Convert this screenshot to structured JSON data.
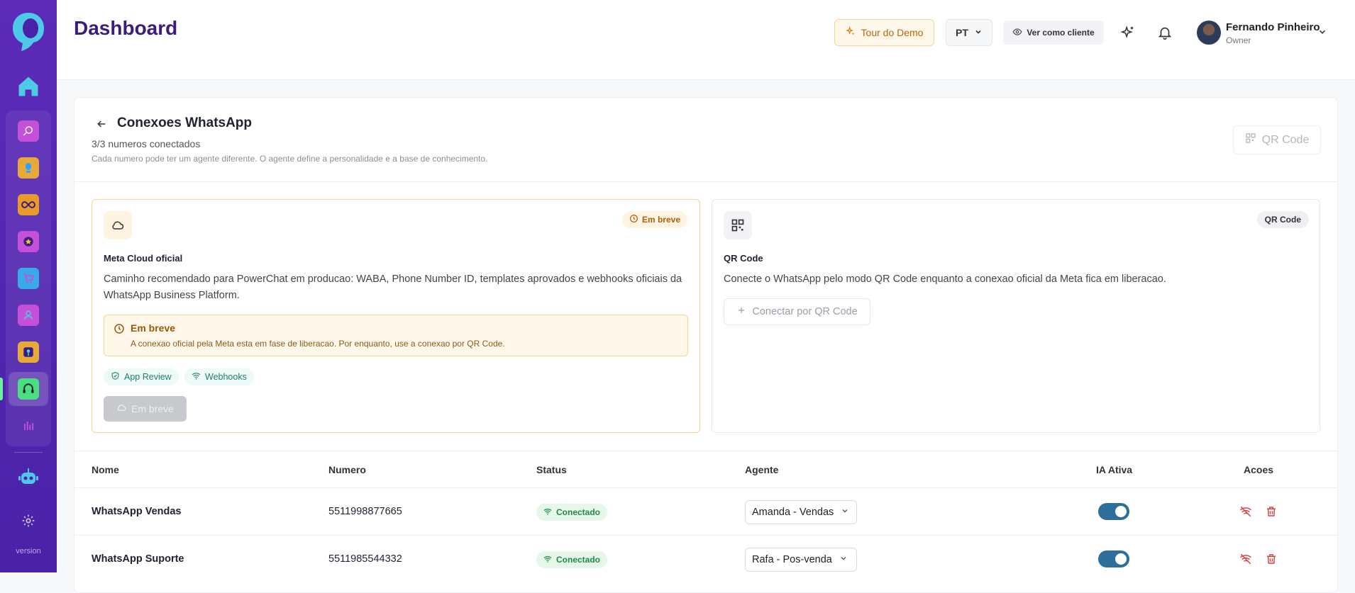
{
  "sidebar": {
    "version_label": "version",
    "items": [
      "search-app",
      "idea-app",
      "infinity-app",
      "star-app",
      "cart-app",
      "user-app",
      "podcast-app",
      "chat-bot-app",
      "analytics-app"
    ]
  },
  "header": {
    "title": "Dashboard",
    "tour_label": "Tour do Demo",
    "lang_label": "PT",
    "view_as_label": "Ver como cliente",
    "user_name": "Fernando Pinheiro",
    "user_role": "Owner"
  },
  "connections": {
    "title": "Conexoes WhatsApp",
    "subtitle": "3/3 numeros conectados",
    "description": "Cada numero pode ter um agente diferente. O agente define a personalidade e a base de conhecimento.",
    "qr_button_label": "QR Code"
  },
  "options": {
    "meta": {
      "badge": "Em breve",
      "title": "Meta Cloud oficial",
      "text": "Caminho recomendado para PowerChat em producao: WABA, Phone Number ID, templates aprovados e webhooks oficiais da WhatsApp Business Platform.",
      "alert_title": "Em breve",
      "alert_text": "A conexao oficial pela Meta esta em fase de liberacao. Por enquanto, use a conexao por QR Code.",
      "chips": [
        "App Review",
        "Webhooks"
      ],
      "button_label": "Em breve"
    },
    "qr": {
      "badge": "QR Code",
      "title": "QR Code",
      "text": "Conecte o WhatsApp pelo modo QR Code enquanto a conexao oficial da Meta fica em liberacao.",
      "button_label": "Conectar por QR Code"
    }
  },
  "table": {
    "headers": {
      "name": "Nome",
      "number": "Numero",
      "status": "Status",
      "agent": "Agente",
      "ai": "IA Ativa",
      "actions": "Acoes"
    },
    "rows": [
      {
        "name": "WhatsApp Vendas",
        "number": "5511998877665",
        "status": "Conectado",
        "agent": "Amanda - Vendas",
        "ai_active": true
      },
      {
        "name": "WhatsApp Suporte",
        "number": "5511985544332",
        "status": "Conectado",
        "agent": "Rafa - Pos-venda",
        "ai_active": true
      }
    ]
  },
  "colors": {
    "sidebar": "#4a22a8",
    "brand_title": "#3b1c7a",
    "warning": "#f3d58f",
    "success": "#1f8a47",
    "toggle_on": "#2e6e9a"
  }
}
